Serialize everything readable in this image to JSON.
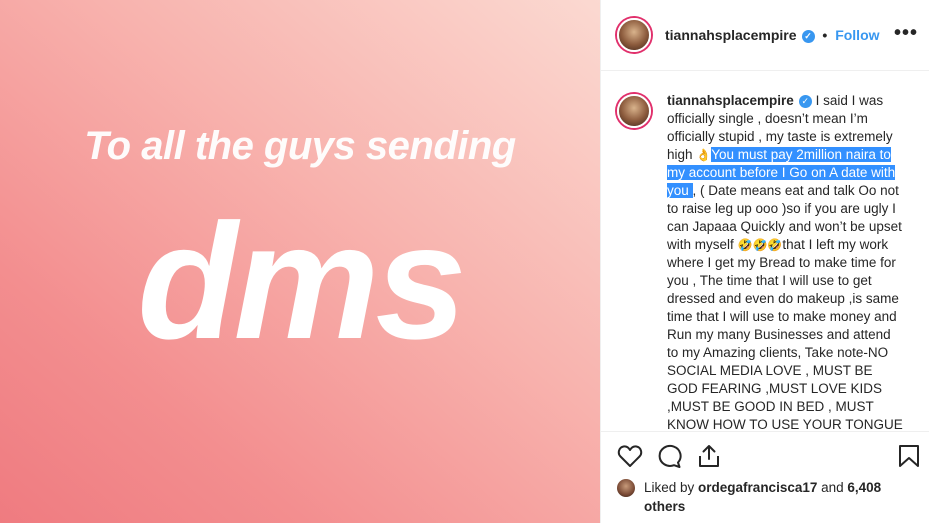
{
  "media": {
    "line1": "To all the guys sending",
    "line2": "dms"
  },
  "header": {
    "username": "tiannahsplacempire",
    "separator": "•",
    "follow_label": "Follow",
    "more_label": "•••"
  },
  "caption": {
    "username": "tiannahsplacempire",
    "text_1": "I said I was officially single , doesn’t mean I’m officially stupid , my taste is extremely high ",
    "emoji_1": "👌",
    "highlighted": "You must pay 2million naira to my account before I Go on A date with you ",
    "text_2": ", ( Date means eat and talk Oo not to raise leg up ooo )so if you are ugly I can Japaaa Quickly and won’t be upset with myself ",
    "emoji_2": "🤣🤣🤣",
    "text_3": "that I left my work where I get my Bread to make time for you , The time that I will use to get dressed and even do makeup ,is same time that I will use to make money and Run my many Businesses and attend to my Amazing clients, Take note-NO SOCIAL MEDIA LOVE , MUST BE GOD FEARING ,MUST LOVE KIDS ,MUST BE GOOD IN BED , MUST KNOW HOW TO USE YOUR TONGUE"
  },
  "likes": {
    "prefix": "Liked by ",
    "user": "ordegafrancisca17",
    "middle": " and ",
    "count": "6,408 others"
  },
  "icons": [
    "heart-icon",
    "comment-icon",
    "share-icon",
    "bookmark-icon",
    "verified-icon",
    "more-icon"
  ],
  "colors": {
    "accent": "#3897f0",
    "highlight": "#3390ff",
    "text": "#262626"
  }
}
